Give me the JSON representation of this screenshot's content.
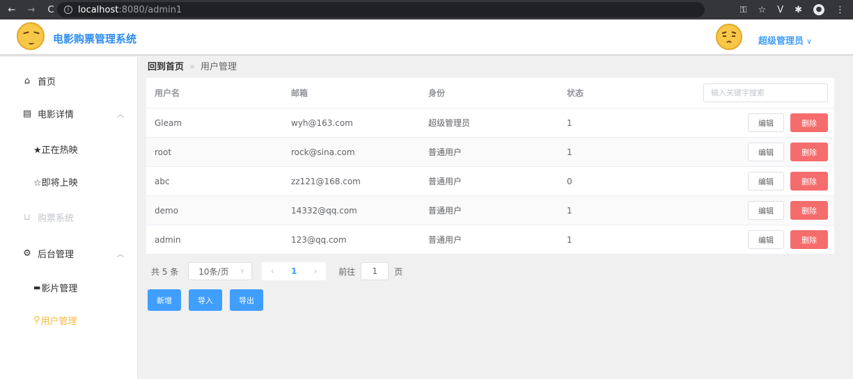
{
  "browser": {
    "url_host": "localhost",
    "url_path": ":8080/admin1"
  },
  "header": {
    "title": "电影购票管理系统",
    "user_name": "超级管理员"
  },
  "sidebar": {
    "items": [
      {
        "label": "首页"
      },
      {
        "label": "电影详情"
      },
      {
        "label": "★正在热映"
      },
      {
        "label": "☆即将上映"
      },
      {
        "label": "购票系统"
      },
      {
        "label": "后台管理"
      },
      {
        "label": "影片管理"
      },
      {
        "label": "用户管理"
      }
    ]
  },
  "breadcrumb": {
    "home": "回到首页",
    "current": "用户管理"
  },
  "table": {
    "headers": [
      "用户名",
      "邮箱",
      "身份",
      "状态"
    ],
    "search_placeholder": "输入关键字搜索",
    "edit_label": "编辑",
    "delete_label": "删除",
    "rows": [
      {
        "username": "Gleam",
        "email": "wyh@163.com",
        "role": "超级管理员",
        "status": "1"
      },
      {
        "username": "root",
        "email": "rock@sina.com",
        "role": "普通用户",
        "status": "1"
      },
      {
        "username": "abc",
        "email": "zz121@168.com",
        "role": "普通用户",
        "status": "0"
      },
      {
        "username": "demo",
        "email": "14332@qq.com",
        "role": "普通用户",
        "status": "1"
      },
      {
        "username": "admin",
        "email": "123@qq.com",
        "role": "普通用户",
        "status": "1"
      }
    ]
  },
  "pagination": {
    "total": "共 5 条",
    "page_size": "10条/页",
    "current_page": "1",
    "goto_prefix": "前往",
    "goto_value": "1",
    "goto_suffix": "页"
  },
  "actions": {
    "add": "新增",
    "import": "导入",
    "export": "导出"
  },
  "colors": {
    "accent": "#409eff",
    "danger": "#f56c6c",
    "active_menu": "#f5b841"
  }
}
